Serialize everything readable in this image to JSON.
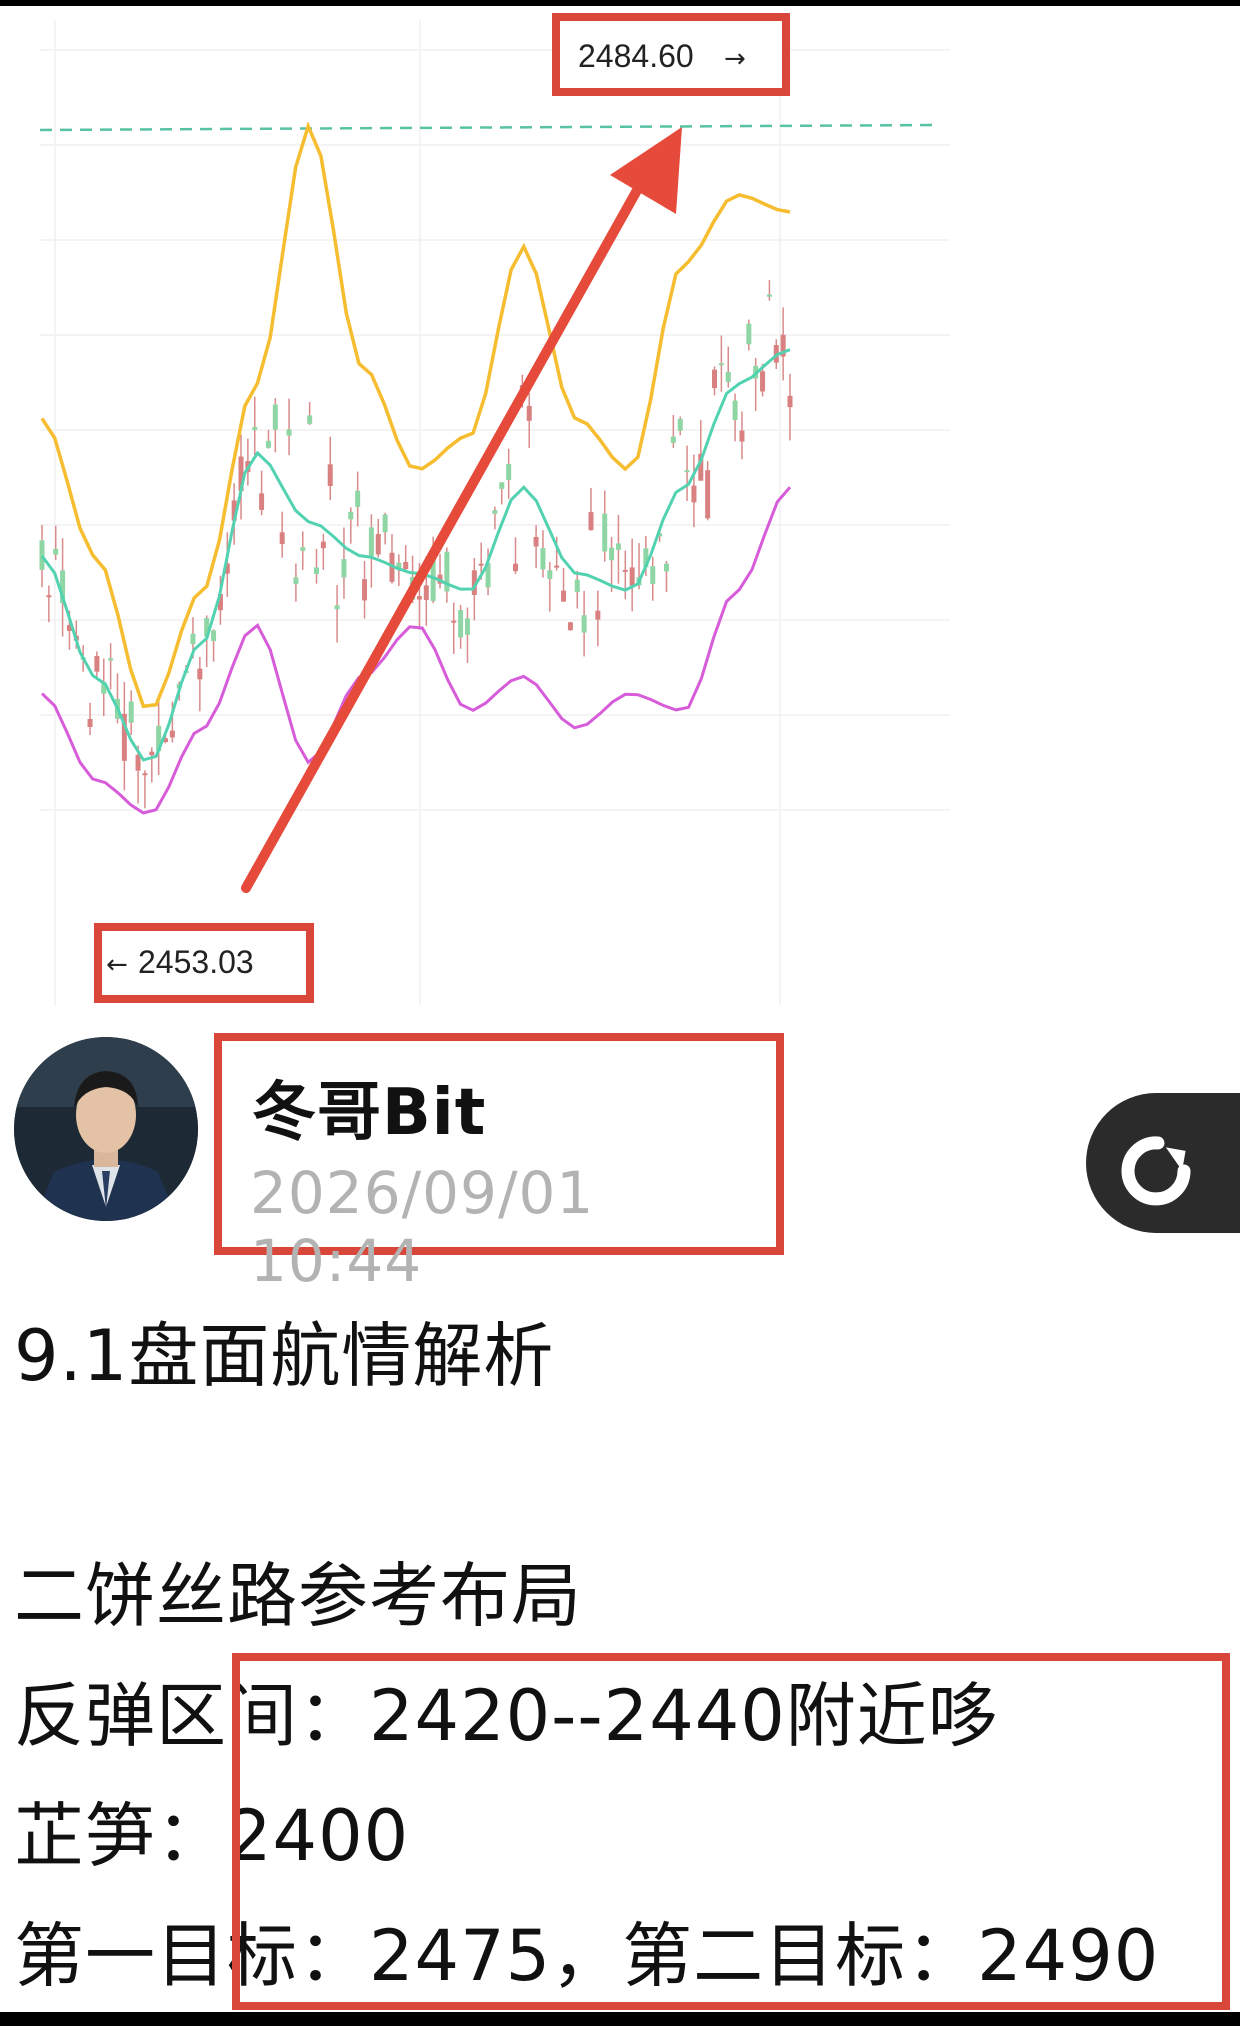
{
  "chart": {
    "label_high": "2484.60",
    "label_low": "2453.03",
    "arrow_right": "→",
    "arrow_left": "←",
    "colors": {
      "upper_band": "#f5bd2f",
      "middle_band": "#52d2b0",
      "lower_band": "#d75cd9",
      "candles": "#d98080",
      "reference_line": "#58c3a4",
      "trend_arrow": "#e54a3a",
      "highlight_box": "#d9463a"
    },
    "chart_data": {
      "type": "line",
      "title": "",
      "price_marks": [
        2453.03,
        2484.6
      ],
      "series": [
        {
          "values": [
            2478,
            2470,
            2461,
            2468,
            2480,
            2495,
            2481,
            2475,
            2477,
            2488,
            2478,
            2475,
            2487,
            2491,
            2490
          ]
        },
        {
          "values": [
            2470,
            2463,
            2458,
            2465,
            2476,
            2472,
            2470,
            2469,
            2468,
            2474,
            2469,
            2468,
            2474,
            2480,
            2482
          ]
        },
        {
          "values": [
            2462,
            2457,
            2455,
            2460,
            2466,
            2458,
            2463,
            2466,
            2461,
            2463,
            2460,
            2462,
            2461,
            2468,
            2474
          ]
        }
      ]
    }
  },
  "post": {
    "author": "冬哥Bit",
    "timestamp": "2026/09/01  10:44",
    "lines": [
      "9.1盘面航情解析",
      "",
      "二饼丝路参考布局",
      "反弹区间：2420--2440附近哆",
      "芷笋：2400",
      "第一目标：2475，第二目标：2490"
    ]
  }
}
